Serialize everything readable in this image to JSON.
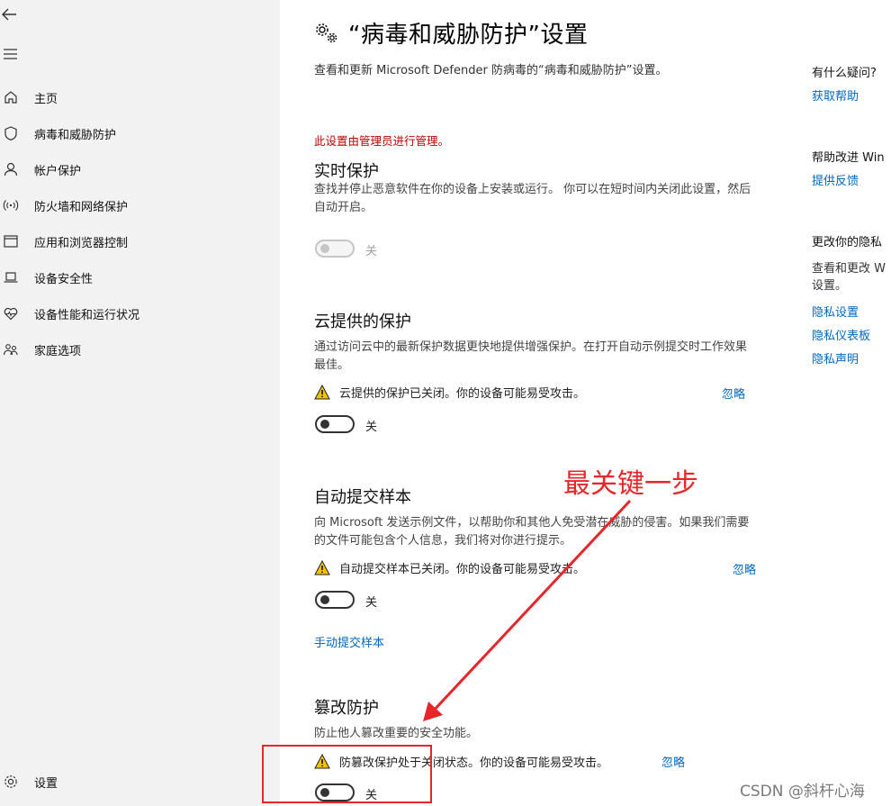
{
  "sidebar": {
    "items": [
      {
        "label": "主页",
        "icon": "home-icon"
      },
      {
        "label": "病毒和威胁防护",
        "icon": "shield-icon"
      },
      {
        "label": "帐户保护",
        "icon": "person-icon"
      },
      {
        "label": "防火墙和网络保护",
        "icon": "wifi-signal-icon"
      },
      {
        "label": "应用和浏览器控制",
        "icon": "app-window-icon"
      },
      {
        "label": "设备安全性",
        "icon": "laptop-icon"
      },
      {
        "label": "设备性能和运行状况",
        "icon": "heart-pulse-icon"
      },
      {
        "label": "家庭选项",
        "icon": "family-icon"
      }
    ],
    "settings_label": "设置"
  },
  "main": {
    "title": "“病毒和威胁防护”设置",
    "subtitle": "查看和更新 Microsoft Defender 防病毒的“病毒和威胁防护”设置。",
    "admin_note": "此设置由管理员进行管理。",
    "sections": {
      "realtime": {
        "title": "实时保护",
        "desc": "查找并停止恶意软件在你的设备上安装或运行。 你可以在短时间内关闭此设置，然后自动开启。",
        "toggle_label": "关"
      },
      "cloud": {
        "title": "云提供的保护",
        "desc": "通过访问云中的最新保护数据更快地提供增强保护。在打开自动示例提交时工作效果最佳。",
        "warning": "云提供的保护已关闭。你的设备可能易受攻击。",
        "dismiss": "忽略",
        "toggle_label": "关"
      },
      "sample": {
        "title": "自动提交样本",
        "desc": "向 Microsoft 发送示例文件，以帮助你和其他人免受潜在威胁的侵害。如果我们需要的文件可能包含个人信息，我们将对你进行提示。",
        "warning": "自动提交样本已关闭。你的设备可能易受攻击。",
        "dismiss": "忽略",
        "toggle_label": "关",
        "manual_link": "手动提交样本"
      },
      "tamper": {
        "title": "篡改防护",
        "desc": "防止他人篡改重要的安全功能。",
        "warning": "防篡改保护处于关闭状态。你的设备可能易受攻击。",
        "dismiss": "忽略",
        "toggle_label": "关"
      }
    }
  },
  "right_panel": {
    "question_heading": "有什么疑问?",
    "get_help": "获取帮助",
    "improve_heading": "帮助改进 Win",
    "feedback": "提供反馈",
    "privacy_heading": "更改你的隐私",
    "privacy_text_1": "查看和更改 W",
    "privacy_text_2": "设置。",
    "privacy_settings": "隐私设置",
    "privacy_dashboard": "隐私仪表板",
    "privacy_statement": "隐私声明"
  },
  "annotation": {
    "text": "最关键一步",
    "color": "#e8262a"
  },
  "watermark": "CSDN @斜杆心海"
}
